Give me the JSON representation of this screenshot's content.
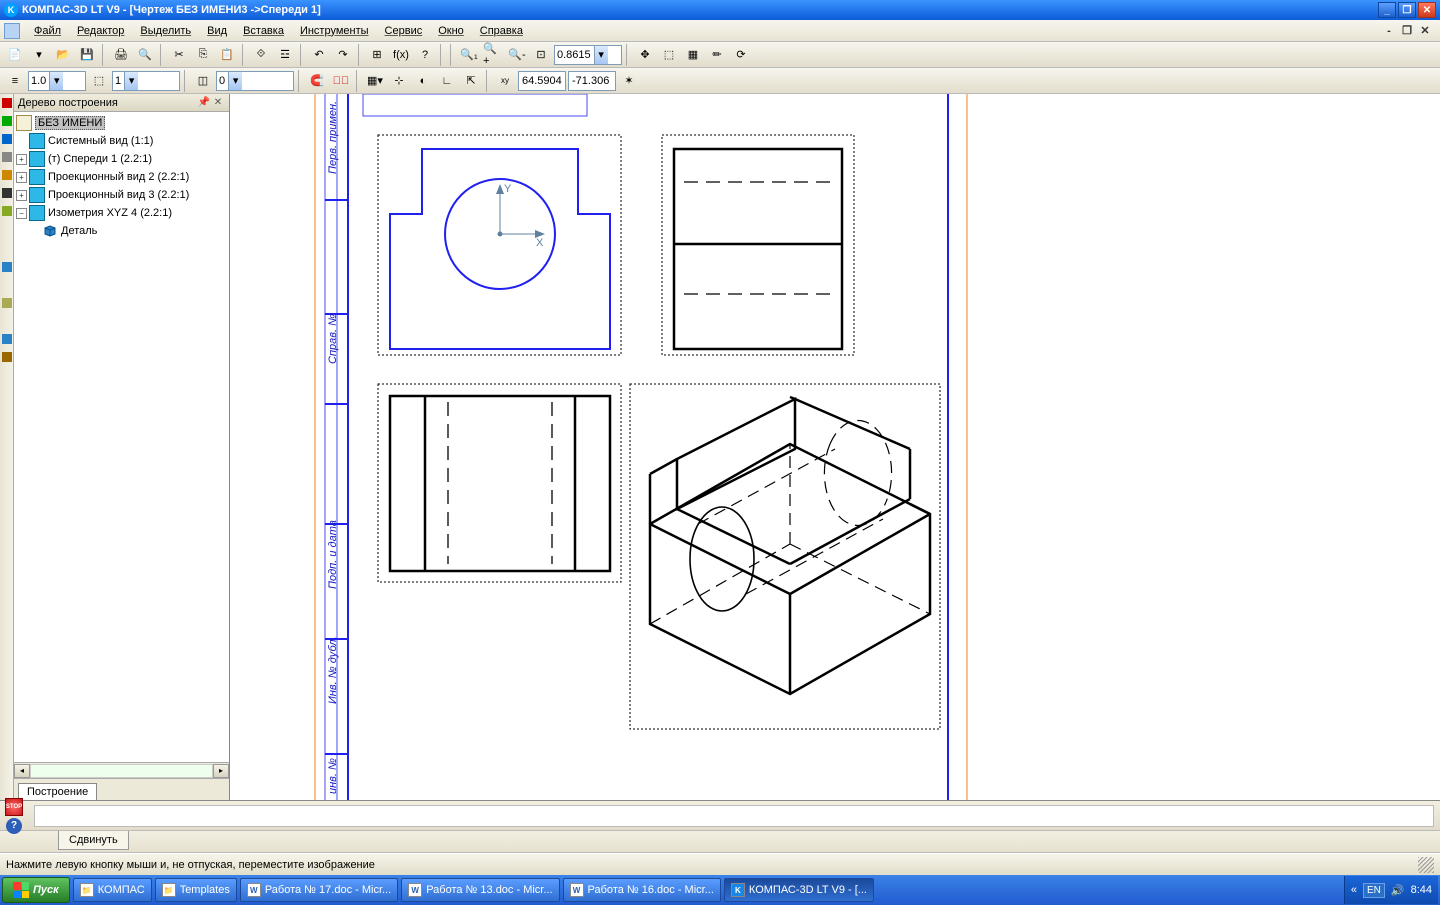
{
  "titlebar": {
    "text": "КОМПАС-3D LT V9 - [Чертеж БЕЗ ИМЕНИ3 ->Спереди 1]"
  },
  "menu": {
    "file": "Файл",
    "edit": "Редактор",
    "select": "Выделить",
    "view": "Вид",
    "insert": "Вставка",
    "tools": "Инструменты",
    "service": "Сервис",
    "window": "Окно",
    "help": "Справка"
  },
  "toolbar1": {
    "zoom": "0.8615"
  },
  "toolbar2": {
    "style1": "1.0",
    "style2": "1",
    "layer": "0",
    "coord_x": "64.5904",
    "coord_y": "-71.306"
  },
  "tree": {
    "panel_title": "Дерево построения",
    "root": "БЕЗ ИМЕНИ",
    "items": [
      "Системный вид (1:1)",
      "(т) Спереди 1 (2.2:1)",
      "Проекционный вид 2 (2.2:1)",
      "Проекционный вид 3 (2.2:1)",
      "Изометрия XYZ 4 (2.2:1)"
    ],
    "detail": "Деталь",
    "tab": "Построение"
  },
  "bottom": {
    "action_tab": "Сдвинуть"
  },
  "statusbar": {
    "hint": "Нажмите левую кнопку мыши и, не отпуская, переместите изображение"
  },
  "taskbar": {
    "start": "Пуск",
    "items": [
      "КОМПАС",
      "Templates",
      "Работа № 17.doc - Micr...",
      "Работа № 13.doc - Micr...",
      "Работа № 16.doc - Micr...",
      "КОМПАС-3D LT V9 - [..."
    ],
    "lang": "EN",
    "time": "8:44"
  },
  "canvas_labels": {
    "y": "Y",
    "x": "X"
  }
}
